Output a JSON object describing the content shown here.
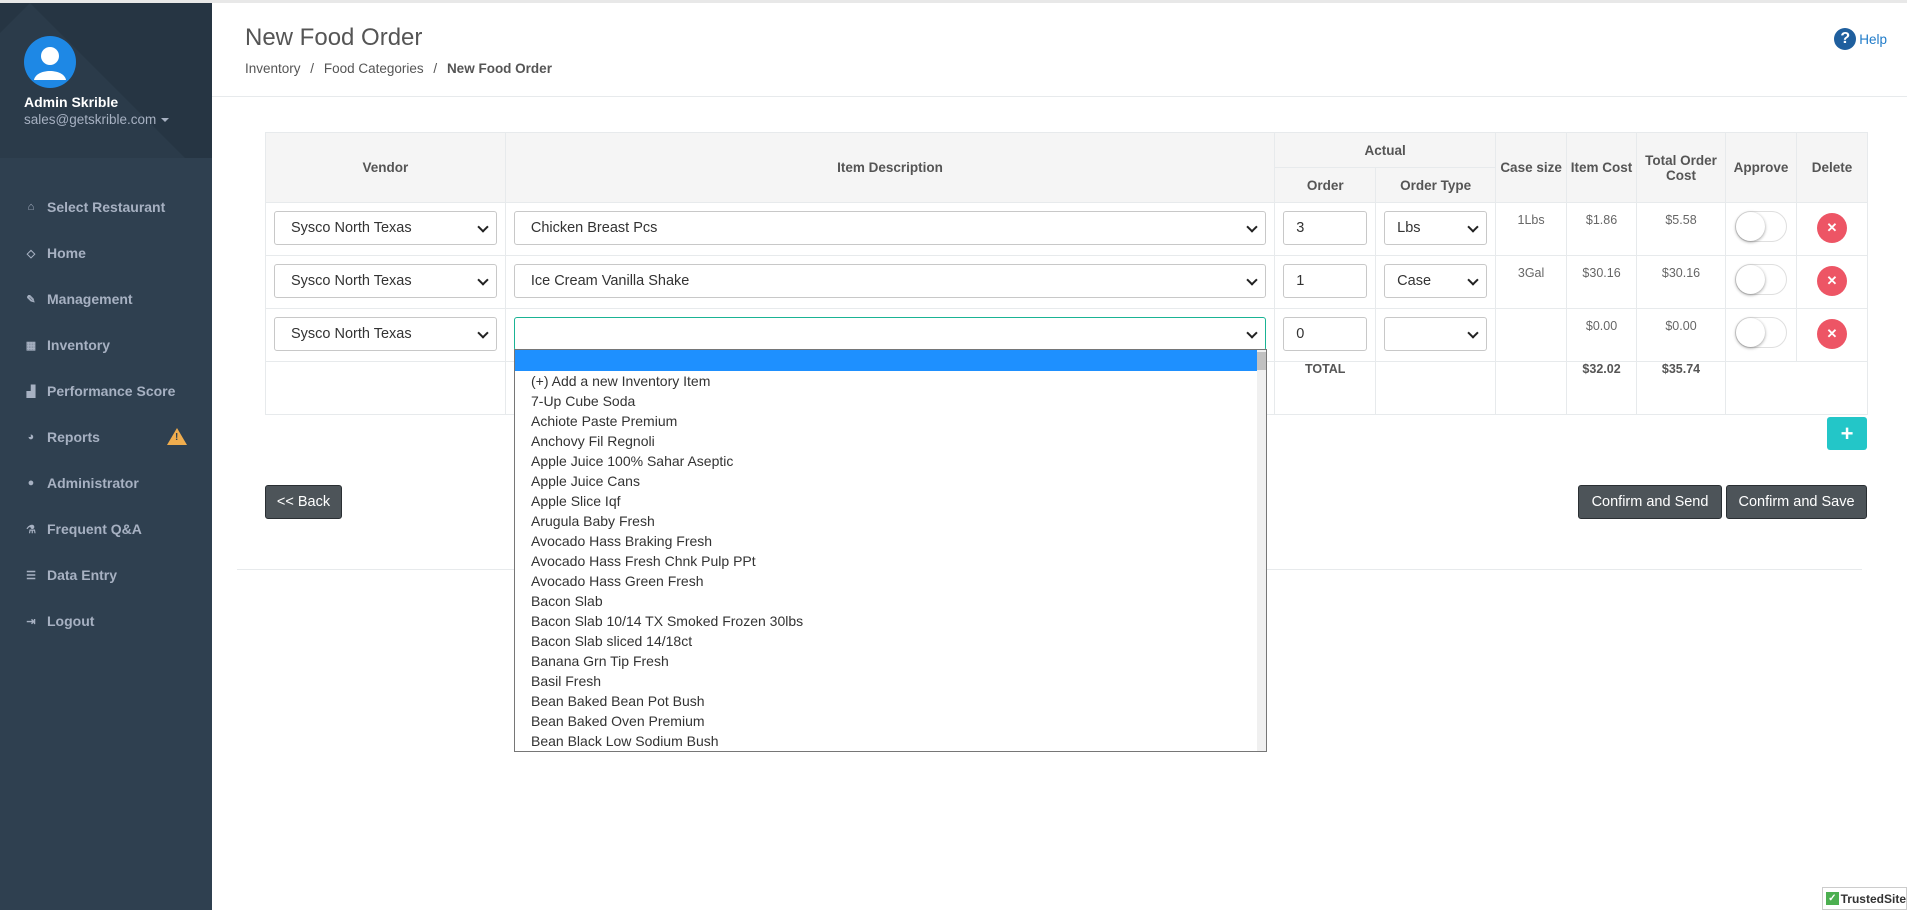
{
  "user": {
    "name": "Admin Skrible",
    "email": "sales@getskrible.com"
  },
  "nav": [
    {
      "label": "Select Restaurant",
      "icon": "home-icon"
    },
    {
      "label": "Home",
      "icon": "diamond-icon"
    },
    {
      "label": "Management",
      "icon": "edit-icon"
    },
    {
      "label": "Inventory",
      "icon": "table-icon"
    },
    {
      "label": "Performance Score",
      "icon": "bar-chart-icon"
    },
    {
      "label": "Reports",
      "icon": "pie-chart-icon"
    },
    {
      "label": "Administrator",
      "icon": "globe-icon"
    },
    {
      "label": "Frequent Q&A",
      "icon": "flask-icon"
    },
    {
      "label": "Data Entry",
      "icon": "database-icon"
    },
    {
      "label": "Logout",
      "icon": "sign-out-icon"
    }
  ],
  "header": {
    "title": "New Food Order",
    "breadcrumb": [
      "Inventory",
      "/",
      "Food Categories",
      "/",
      "New Food Order"
    ],
    "help": "Help"
  },
  "table": {
    "headers": {
      "vendor": "Vendor",
      "item": "Item Description",
      "actual": "Actual",
      "order": "Order",
      "order_type": "Order Type",
      "case_size": "Case size",
      "item_cost": "Item Cost",
      "total_cost": "Total Order Cost",
      "approve": "Approve",
      "delete": "Delete"
    },
    "rows": [
      {
        "vendor": "Sysco North Texas",
        "item": "Chicken Breast Pcs",
        "order": "3",
        "order_type": "Lbs",
        "case_size": "1Lbs",
        "item_cost": "$1.86",
        "total_cost": "$5.58"
      },
      {
        "vendor": "Sysco North Texas",
        "item": "Ice Cream Vanilla Shake",
        "order": "1",
        "order_type": "Case",
        "case_size": "3Gal",
        "item_cost": "$30.16",
        "total_cost": "$30.16"
      },
      {
        "vendor": "Sysco North Texas",
        "item": "",
        "order": "0",
        "order_type": "",
        "case_size": "",
        "item_cost": "$0.00",
        "total_cost": "$0.00"
      }
    ],
    "footer": {
      "label": "TOTAL",
      "item_cost": "$32.02",
      "total_cost": "$35.74"
    }
  },
  "buttons": {
    "back": "<< Back",
    "confirm_send": "Confirm and Send",
    "confirm_save": "Confirm and Save",
    "add": "+"
  },
  "dropdown_options": [
    "(+) Add a new Inventory Item",
    "7-Up Cube Soda",
    "Achiote Paste Premium",
    "Anchovy Fil Regnoli",
    "Apple Juice 100% Sahar Aseptic",
    "Apple Juice Cans",
    "Apple Slice Iqf",
    "Arugula Baby Fresh",
    "Avocado Hass Braking Fresh",
    "Avocado Hass Fresh Chnk Pulp PPt",
    "Avocado Hass Green Fresh",
    "Bacon Slab",
    "Bacon Slab 10/14 TX Smoked Frozen 30lbs",
    "Bacon Slab sliced 14/18ct",
    "Banana Grn Tip Fresh",
    "Basil Fresh",
    "Bean Baked Bean Pot Bush",
    "Bean Baked Oven Premium",
    "Bean Black Low Sodium Bush"
  ],
  "badge": "TrustedSite"
}
